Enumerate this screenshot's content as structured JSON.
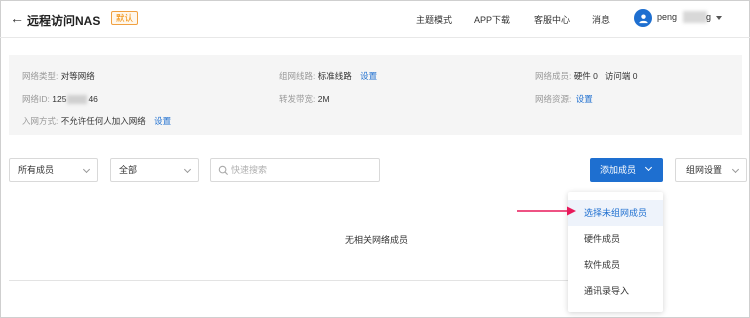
{
  "header": {
    "title": "远程访问NAS",
    "badge": "默认",
    "nav": [
      "主题模式",
      "APP下载",
      "客服中心",
      "消息"
    ],
    "user_name_prefix": "peng",
    "user_name_suffix": "g"
  },
  "info": {
    "network_type_label": "网络类型:",
    "network_type_value": "对等网络",
    "network_id_label": "网络ID:",
    "network_id_prefix": "125",
    "network_id_suffix": "46",
    "join_method_label": "入网方式:",
    "join_method_value": "不允许任何人加入网络",
    "join_method_link": "设置",
    "line_label": "组网线路:",
    "line_value": "标准线路",
    "line_link": "设置",
    "bandwidth_label": "转发带宽:",
    "bandwidth_value": "2M",
    "members_label": "网络成员:",
    "members_value": "硬件 0   访问端 0",
    "resources_label": "网络资源:",
    "resources_link": "设置"
  },
  "filters": {
    "member_select": "所有成员",
    "status_select": "全部",
    "search_placeholder": "快速搜索"
  },
  "actions": {
    "add_member": "添加成员",
    "group_settings": "组网设置"
  },
  "empty_text": "无相关网络成员",
  "dropdown": {
    "items": [
      "选择未组网成员",
      "硬件成员",
      "软件成员",
      "通讯录导入"
    ]
  },
  "colors": {
    "accent": "#1e6fd0",
    "badge": "#f08a00",
    "annotation_arrow": "#e8195a"
  }
}
